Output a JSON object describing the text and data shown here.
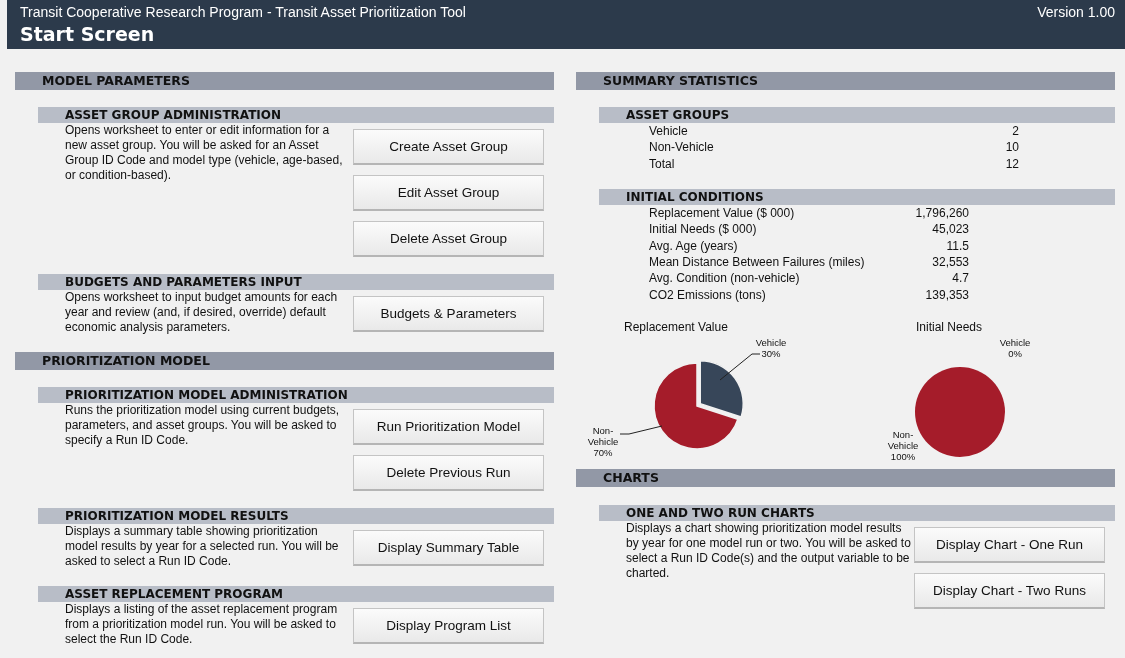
{
  "header": {
    "program": "Transit Cooperative Research Program - Transit Asset Prioritization Tool",
    "version": "Version 1.00",
    "title": "Start Screen"
  },
  "left_sections": [
    {
      "title": "MODEL PARAMETERS",
      "subsections": [
        {
          "title": "ASSET GROUP ADMINISTRATION",
          "description": "Opens worksheet to enter or edit information for a new asset group. You will be asked for an Asset Group ID Code and model type (vehicle, age-based, or condition-based).",
          "buttons": [
            "Create Asset Group",
            "Edit Asset Group",
            "Delete Asset Group"
          ]
        },
        {
          "title": "BUDGETS AND PARAMETERS INPUT",
          "description": "Opens worksheet to input budget amounts for each year and review (and, if desired, override) default economic analysis parameters.",
          "buttons": [
            "Budgets & Parameters"
          ]
        }
      ]
    },
    {
      "title": "PRIORITIZATION MODEL",
      "subsections": [
        {
          "title": "PRIORITIZATION MODEL ADMINISTRATION",
          "description": "Runs the prioritization model using current budgets, parameters, and asset groups. You will be asked to specify a Run ID Code.",
          "buttons": [
            "Run Prioritization Model",
            "Delete Previous Run"
          ]
        },
        {
          "title": "PRIORITIZATION MODEL RESULTS",
          "description": "Displays a summary table showing prioritization model results by year for a selected run. You will be asked to select a Run ID Code.",
          "buttons": [
            "Display Summary Table"
          ]
        },
        {
          "title": "ASSET REPLACEMENT PROGRAM",
          "description": "Displays a listing of the asset replacement program from a prioritization model run. You will be asked to select the Run ID Code.",
          "buttons": [
            "Display Program List"
          ]
        }
      ]
    }
  ],
  "summary": {
    "title": "SUMMARY STATISTICS",
    "groups": [
      {
        "title": "ASSET GROUPS",
        "rows": [
          {
            "label": "Vehicle",
            "value": "2"
          },
          {
            "label": "Non-Vehicle",
            "value": "10"
          },
          {
            "label": "Total",
            "value": "12"
          }
        ]
      },
      {
        "title": "INITIAL CONDITIONS",
        "rows": [
          {
            "label": "Replacement Value ($ 000)",
            "value": "1,796,260"
          },
          {
            "label": "Initial Needs ($ 000)",
            "value": "45,023"
          },
          {
            "label": "Avg. Age (years)",
            "value": "11.5"
          },
          {
            "label": "Mean Distance Between Failures (miles)",
            "value": "32,553"
          },
          {
            "label": "Avg. Condition (non-vehicle)",
            "value": "4.7"
          },
          {
            "label": "CO2 Emissions (tons)",
            "value": "139,353"
          }
        ]
      }
    ],
    "charts": [
      {
        "chart_data": {
          "type": "pie",
          "title": "Replacement Value",
          "categories": [
            "Vehicle",
            "Non-Vehicle"
          ],
          "values": [
            30,
            70
          ],
          "colors": [
            "#374659",
            "#a51c2a"
          ],
          "value_labels": [
            "30%",
            "70%"
          ]
        }
      },
      {
        "chart_data": {
          "type": "pie",
          "title": "Initial Needs",
          "categories": [
            "Vehicle",
            "Non-Vehicle"
          ],
          "values": [
            0,
            100
          ],
          "colors": [
            "#374659",
            "#a51c2a"
          ],
          "value_labels": [
            "0%",
            "100%"
          ]
        }
      }
    ]
  },
  "charts_section": {
    "title": "CHARTS",
    "subsections": [
      {
        "title": "ONE AND TWO RUN CHARTS",
        "description": "Displays a chart showing prioritization model results by year for one model run or two. You will be asked to select a Run ID Code(s) and the output variable to be charted.",
        "buttons": [
          "Display Chart - One Run",
          "Display Chart - Two Runs"
        ]
      }
    ]
  }
}
